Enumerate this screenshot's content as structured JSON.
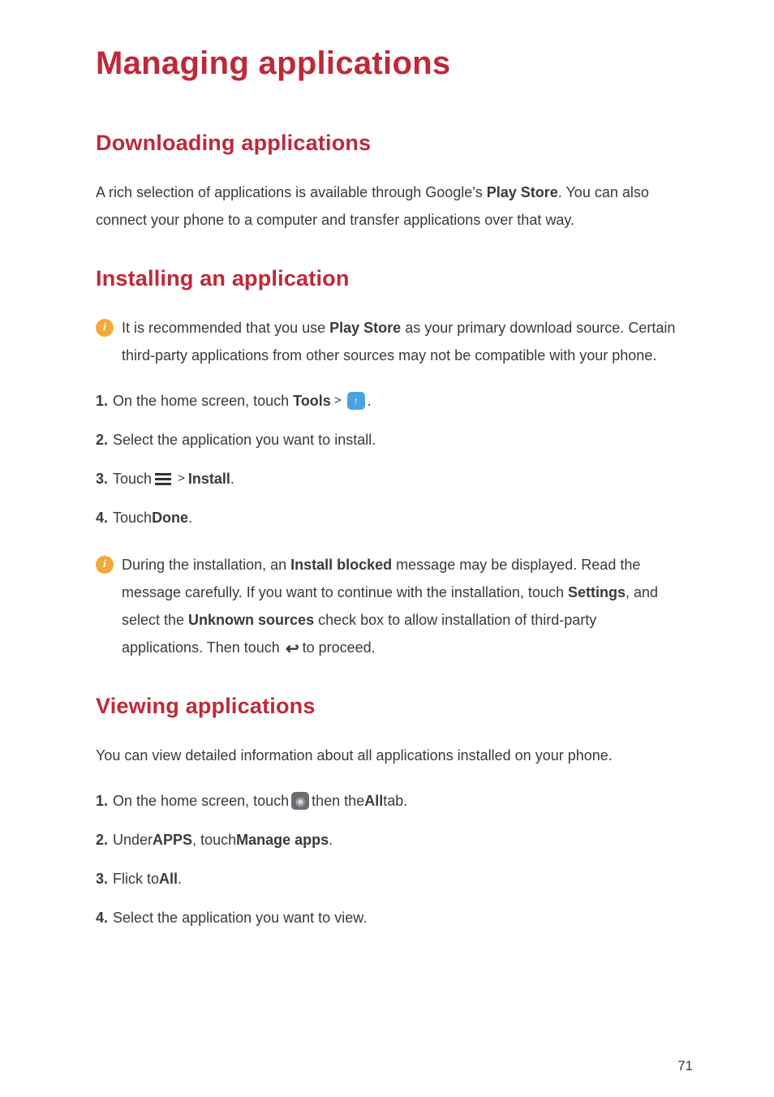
{
  "page_number": "71",
  "title": "Managing applications",
  "sections": {
    "download": {
      "heading": "Downloading applications",
      "para_pre": "A rich selection of applications is available through Google's ",
      "play_store": "Play Store",
      "para_post": ". You can also connect your phone to a computer and transfer applications over that way."
    },
    "install": {
      "heading": "Installing an application",
      "note1_pre": "It is recommended that you use ",
      "note1_bold": "Play Store",
      "note1_post": " as your primary download source. Certain third-party applications from other sources may not be compatible with your phone.",
      "step1_num": "1.",
      "step1_pre": " On the home screen, touch ",
      "step1_tools": "Tools",
      "step1_post": " .",
      "step2_num": "2.",
      "step2_text": " Select the application you want to install.",
      "step3_num": "3.",
      "step3_pre": " Touch ",
      "step3_install": "Install",
      "step3_post": ".",
      "step4_num": "4.",
      "step4_pre": " Touch ",
      "step4_done": "Done",
      "step4_post": ".",
      "note2_pre": "During the installation, an ",
      "note2_b1": "Install blocked",
      "note2_mid1": " message may be displayed. Read the message carefully. If you want to continue with the installation, touch ",
      "note2_b2": "Settings",
      "note2_mid2": ", and select the ",
      "note2_b3": "Unknown sources",
      "note2_mid3": " check box to allow installation of third-party applications. Then touch ",
      "note2_post": "to proceed."
    },
    "view": {
      "heading": "Viewing applications",
      "para": "You can view detailed information about all applications installed on your phone.",
      "step1_num": "1.",
      "step1_pre": " On the home screen, touch ",
      "step1_mid": " then the ",
      "step1_all": "All",
      "step1_post": " tab.",
      "step2_num": "2.",
      "step2_pre": " Under ",
      "step2_apps": "APPS",
      "step2_mid": ", touch ",
      "step2_manage": "Manage apps",
      "step2_post": ".",
      "step3_num": "3.",
      "step3_pre": " Flick to ",
      "step3_all": "All",
      "step3_post": ".",
      "step4_num": "4.",
      "step4_text": " Select the application you want to view."
    }
  },
  "symbols": {
    "info": "i",
    "greater_than": ">",
    "back_arrow": "↪"
  }
}
